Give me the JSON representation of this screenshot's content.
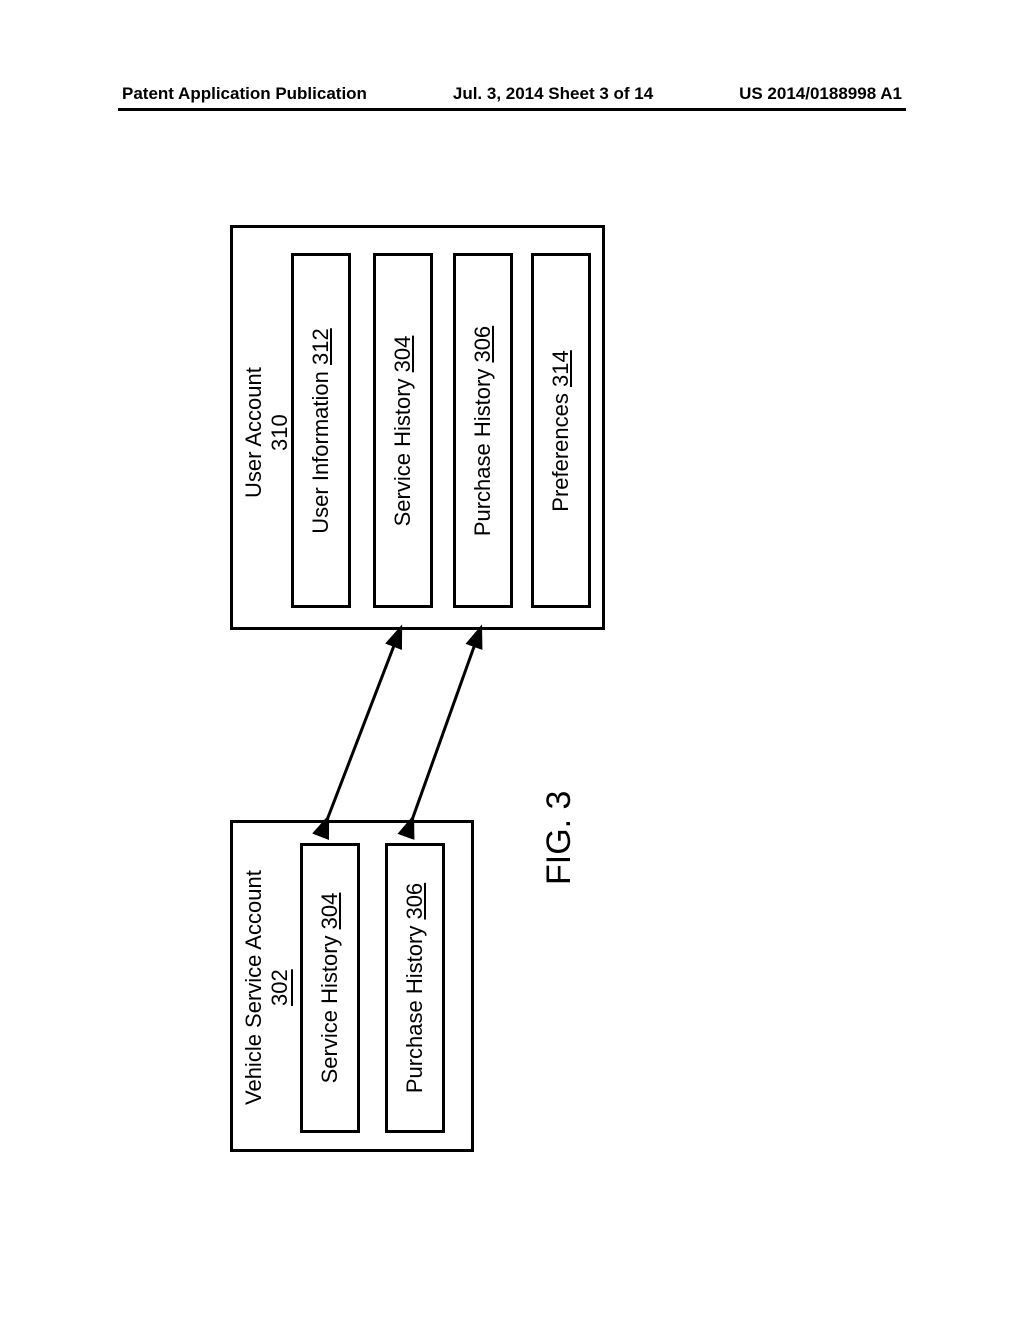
{
  "header": {
    "left": "Patent Application Publication",
    "center": "Jul. 3, 2014  Sheet 3 of 14",
    "right": "US 2014/0188998 A1"
  },
  "figure": {
    "caption": "FIG. 3"
  },
  "diagram": {
    "vehicle_service_account": {
      "title_text": "Vehicle Service Account",
      "title_ref": "302",
      "service_history_text": "Service History",
      "service_history_ref": "304",
      "purchase_history_text": "Purchase History",
      "purchase_history_ref": "306"
    },
    "user_account": {
      "title_text": "User Account",
      "title_ref": "310",
      "user_info_text": "User Information",
      "user_info_ref": "312",
      "service_history_text": "Service History",
      "service_history_ref": "304",
      "purchase_history_text": "Purchase History",
      "purchase_history_ref": "306",
      "preferences_text": "Preferences",
      "preferences_ref": "314"
    }
  }
}
